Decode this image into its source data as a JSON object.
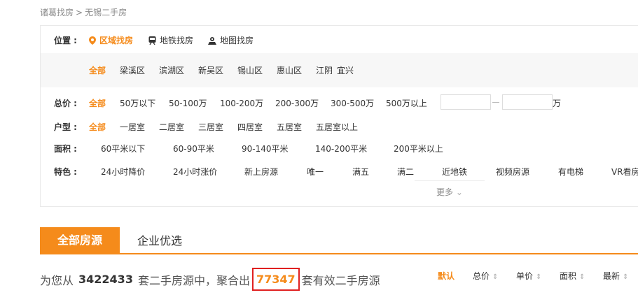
{
  "breadcrumb": {
    "home": "诸葛找房",
    "sep": ">",
    "current": "无锡二手房"
  },
  "location": {
    "label": "位置 :",
    "modes": [
      "区域找房",
      "地铁找房",
      "地图找房"
    ],
    "districts": [
      "全部",
      "梁溪区",
      "滨湖区",
      "新吴区",
      "锡山区",
      "惠山区",
      "江阴",
      "宜兴"
    ]
  },
  "price": {
    "label": "总价 :",
    "options": [
      "全部",
      "50万以下",
      "50-100万",
      "100-200万",
      "200-300万",
      "300-500万",
      "500万以上"
    ],
    "unit": "万"
  },
  "layout": {
    "label": "户型 :",
    "options": [
      "全部",
      "一居室",
      "二居室",
      "三居室",
      "四居室",
      "五居室",
      "五居室以上"
    ]
  },
  "area": {
    "label": "面积 :",
    "options": [
      "60平米以下",
      "60-90平米",
      "90-140平米",
      "140-200平米",
      "200平米以上"
    ]
  },
  "feature": {
    "label": "特色 :",
    "options": [
      "24小时降价",
      "24小时涨价",
      "新上房源",
      "唯一",
      "满五",
      "满二",
      "近地铁",
      "视频房源",
      "有电梯",
      "VR看房"
    ]
  },
  "more": "更多",
  "tabs": {
    "all": "全部房源",
    "enterprise": "企业优选"
  },
  "summary": {
    "prefix": "为您从",
    "total": "3422433",
    "mid": "套二手房源中，聚合出",
    "count": "77347",
    "suffix": "套有效二手房源"
  },
  "sort": [
    "默认",
    "总价",
    "单价",
    "面积",
    "最新"
  ],
  "colors": {
    "accent": "#f58b1b",
    "highlight_box": "#e02020"
  }
}
